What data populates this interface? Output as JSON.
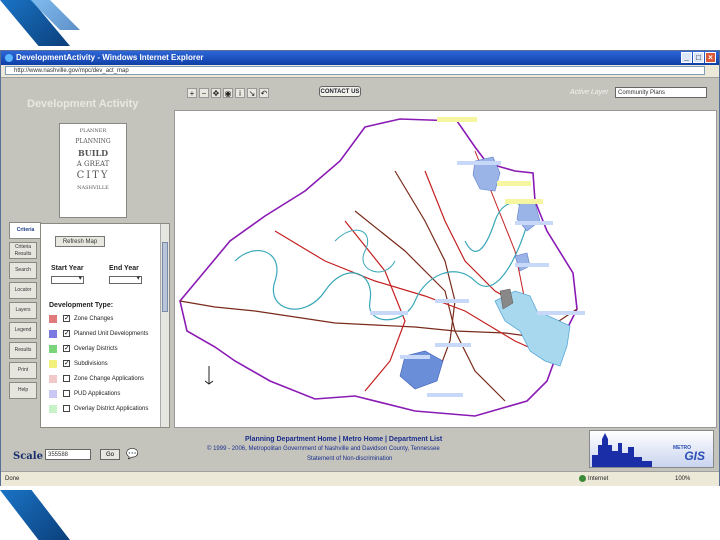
{
  "window": {
    "title": "DevelopmentActivity - Windows Internet Explorer",
    "address": "http://www.nashville.gov/mpc/dev_act_map"
  },
  "app": {
    "title": "Development Activity"
  },
  "logo": {
    "lines": [
      "PLANNER",
      "PLANNING",
      "BUILD",
      "A GREAT",
      "CITY",
      "NASHVILLE"
    ]
  },
  "toolbar": {
    "icons": [
      "zoom-in",
      "zoom-out",
      "pan",
      "full-extent",
      "identify",
      "measure",
      "back"
    ],
    "contact_label": "CONTACT US",
    "active_layer_label": "Active Layer",
    "active_layer_value": "Community Plans"
  },
  "tabs": [
    "Criteria",
    "Criteria Results",
    "Search",
    "Locator",
    "Layers",
    "Legend",
    "Results",
    "Print",
    "Help"
  ],
  "panel": {
    "refresh_label": "Refresh Map",
    "start_year_label": "Start Year",
    "end_year_label": "End Year",
    "dev_type_title": "Development Type:",
    "items": [
      {
        "label": "Zone Changes",
        "color": "#e07a7a",
        "checked": true
      },
      {
        "label": "Planned Unit Developments",
        "color": "#7a7ae0",
        "checked": true
      },
      {
        "label": "Overlay Districts",
        "color": "#7ad47a",
        "checked": true
      },
      {
        "label": "Subdivisions",
        "color": "#f0f07a",
        "checked": true
      },
      {
        "label": "Zone Change Applications",
        "color": "#f2c8c8",
        "checked": false
      },
      {
        "label": "PUD Applications",
        "color": "#c8c8f2",
        "checked": false
      },
      {
        "label": "Overlay District Applications",
        "color": "#c8f2c8",
        "checked": false
      }
    ]
  },
  "footer": {
    "links": "Planning Department Home | Metro Home | Department List",
    "copyright": "© 1999 - 2006, Metropolitan Government of Nashville and Davidson County, Tennessee",
    "nondiscrimination": "Statement of Non-discrimination",
    "scale_label": "Scale 1:",
    "scale_value": "355588",
    "go_label": "Go",
    "gis_sub": "METRO",
    "gis_text": "GIS"
  },
  "status": {
    "done": "Done",
    "zone": "Internet",
    "zoom": "100%"
  }
}
